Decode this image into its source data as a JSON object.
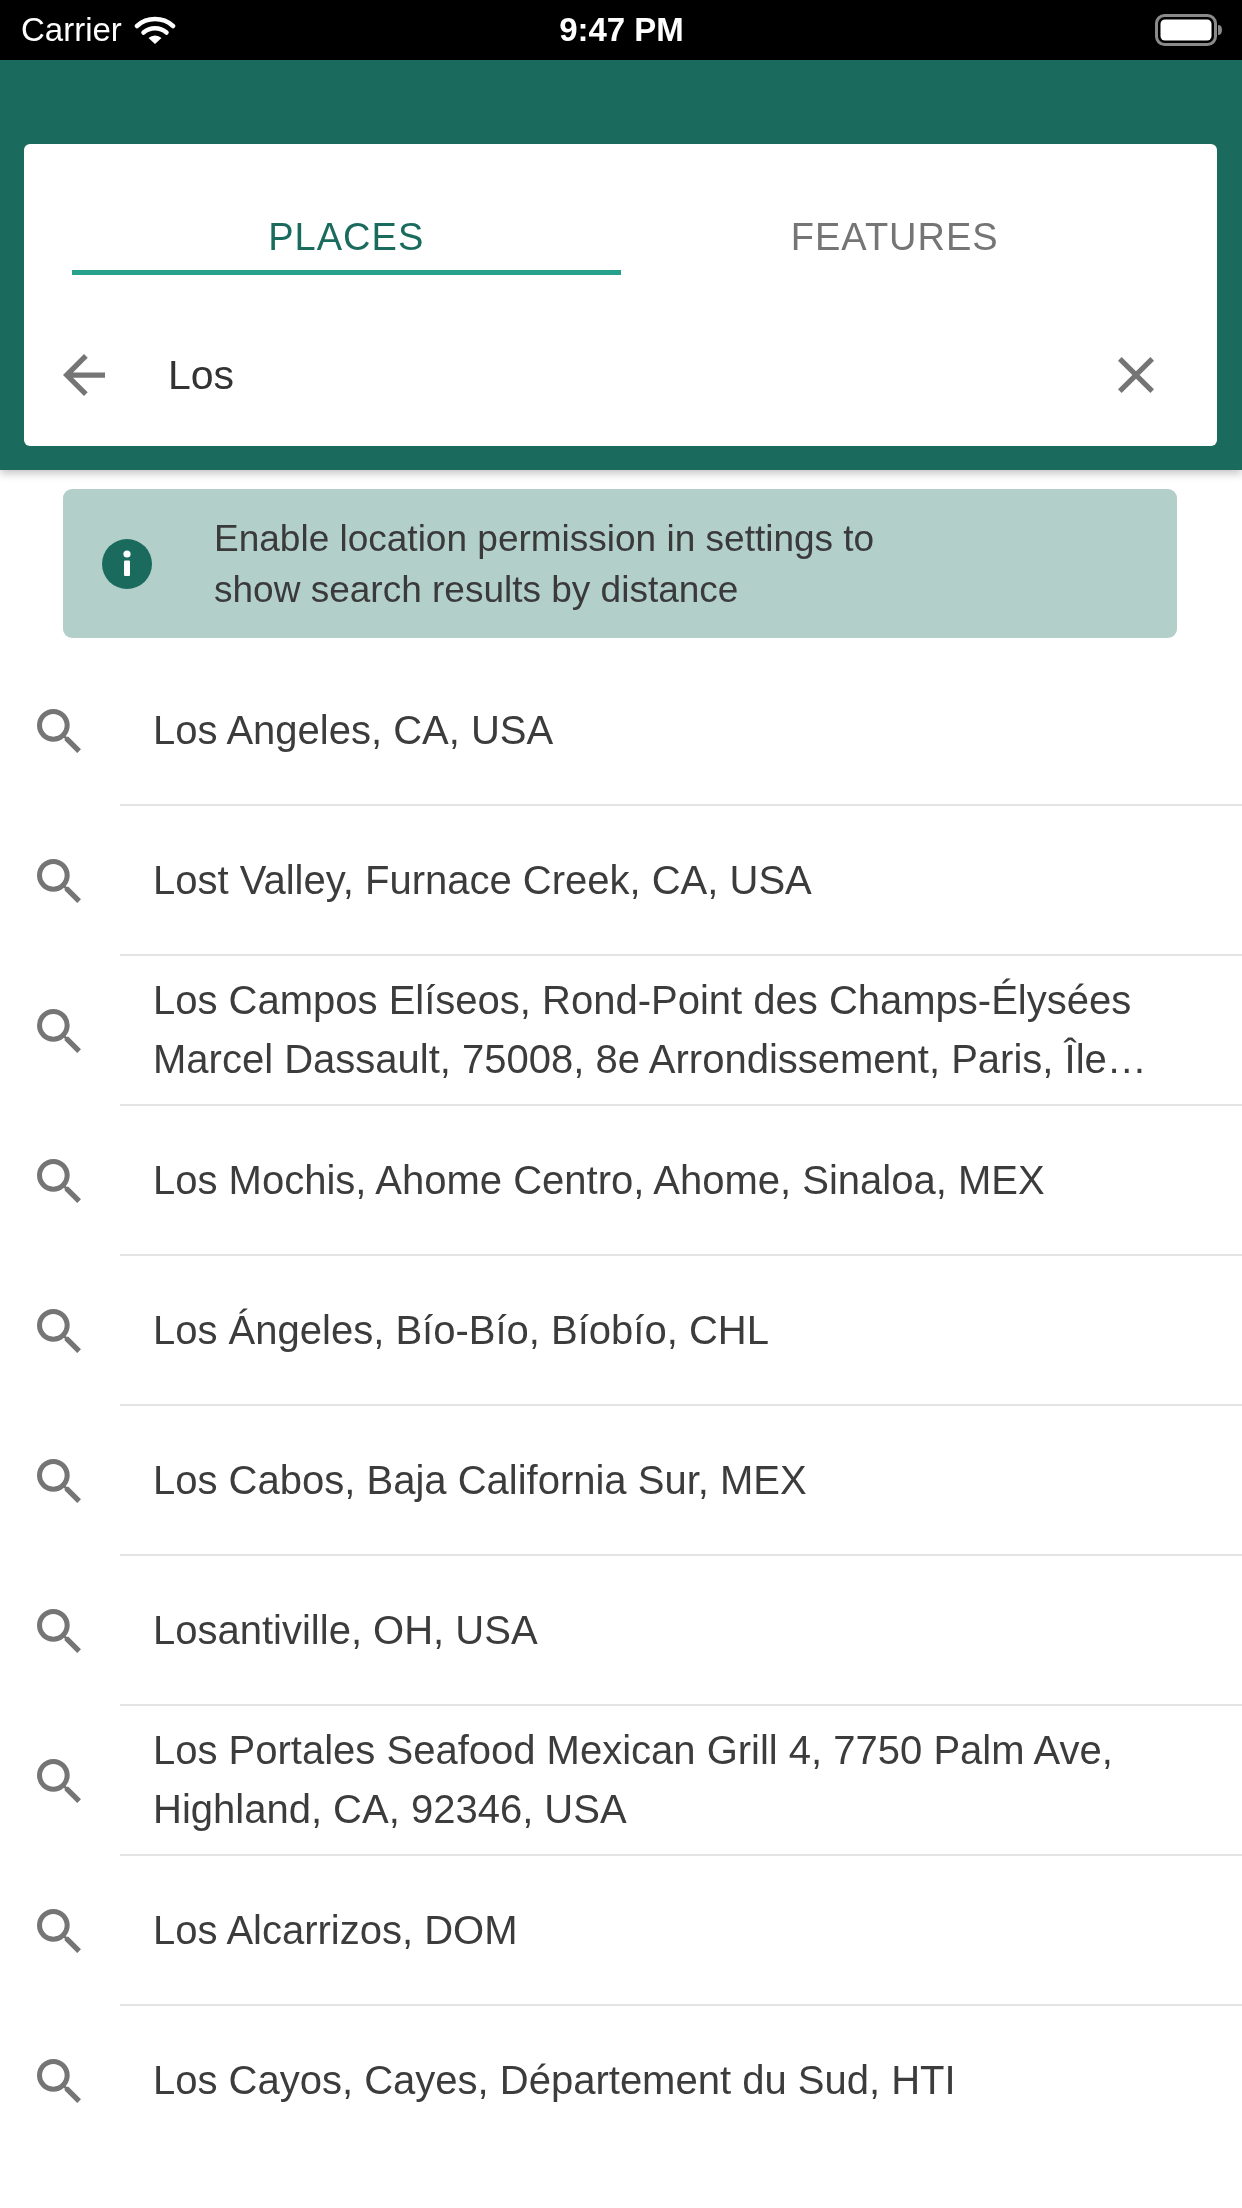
{
  "status_bar": {
    "carrier": "Carrier",
    "time": "9:47 PM"
  },
  "tabs": [
    {
      "label": "PLACES",
      "selected": true
    },
    {
      "label": "FEATURES",
      "selected": false
    }
  ],
  "search": {
    "value": "Los"
  },
  "notice": {
    "text": "Enable location permission in settings to show search results by distance"
  },
  "results": [
    "Los Angeles, CA, USA",
    "Lost Valley, Furnace Creek, CA, USA",
    "Los Campos Elíseos, Rond-Point des Champs-Élysées Marcel Dassault, 75008, 8e Arrondissement, Paris, Île…",
    "Los Mochis, Ahome Centro, Ahome, Sinaloa, MEX",
    "Los Ángeles, Bío-Bío, Bíobío, CHL",
    "Los Cabos, Baja California Sur, MEX",
    "Losantiville, OH, USA",
    "Los Portales Seafood Mexican Grill 4, 7750 Palm Ave, Highland, CA, 92346, USA",
    "Los Alcarrizos, DOM",
    "Los Cayos, Cayes, Département du Sud, HTI"
  ]
}
